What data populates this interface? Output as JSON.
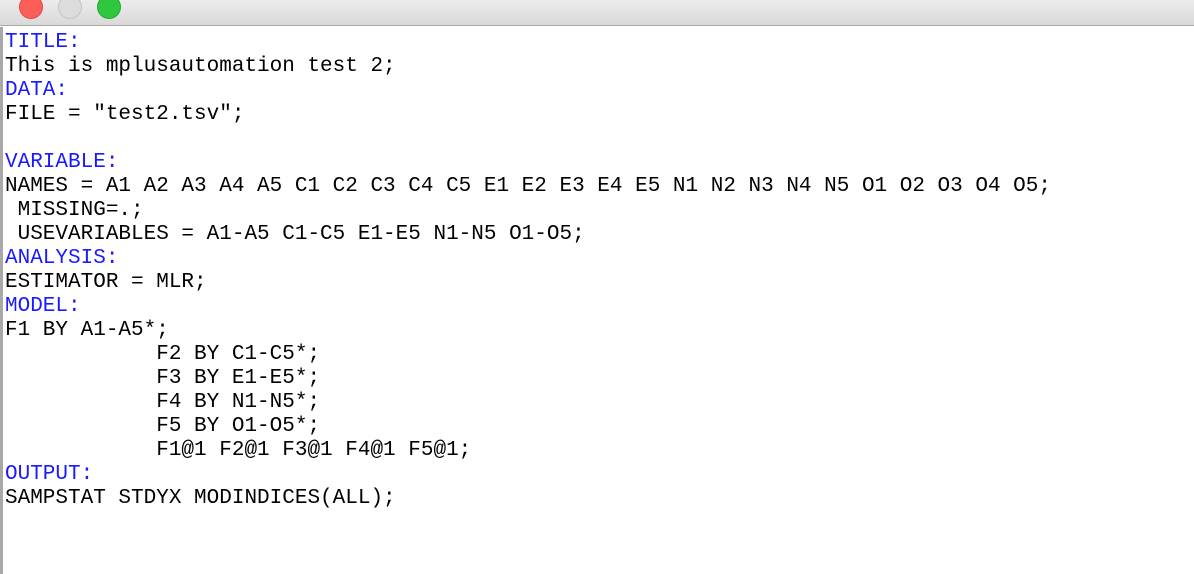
{
  "window": {
    "controls": {
      "close": "close-button",
      "minimize": "minimize-button",
      "zoom": "zoom-button"
    }
  },
  "colors": {
    "keyword": "#1a1aff",
    "text": "#000000"
  },
  "editor": {
    "lines": [
      {
        "text": "TITLE:",
        "type": "keyword"
      },
      {
        "text": "This is mplusautomation test 2;",
        "type": "text"
      },
      {
        "text": "DATA:",
        "type": "keyword"
      },
      {
        "text": "FILE = \"test2.tsv\";",
        "type": "text"
      },
      {
        "text": "",
        "type": "text"
      },
      {
        "text": "VARIABLE:",
        "type": "keyword"
      },
      {
        "text": "NAMES = A1 A2 A3 A4 A5 C1 C2 C3 C4 C5 E1 E2 E3 E4 E5 N1 N2 N3 N4 N5 O1 O2 O3 O4 O5;",
        "type": "text"
      },
      {
        "text": " MISSING=.;",
        "type": "text"
      },
      {
        "text": " USEVARIABLES = A1-A5 C1-C5 E1-E5 N1-N5 O1-O5;",
        "type": "text"
      },
      {
        "text": "ANALYSIS:",
        "type": "keyword"
      },
      {
        "text": "ESTIMATOR = MLR;",
        "type": "text"
      },
      {
        "text": "MODEL:",
        "type": "keyword"
      },
      {
        "text": "F1 BY A1-A5*;",
        "type": "text"
      },
      {
        "text": "            F2 BY C1-C5*;",
        "type": "text"
      },
      {
        "text": "            F3 BY E1-E5*;",
        "type": "text"
      },
      {
        "text": "            F4 BY N1-N5*;",
        "type": "text"
      },
      {
        "text": "            F5 BY O1-O5*;",
        "type": "text"
      },
      {
        "text": "            F1@1 F2@1 F3@1 F4@1 F5@1;",
        "type": "text"
      },
      {
        "text": "OUTPUT:",
        "type": "keyword"
      },
      {
        "text": "SAMPSTAT STDYX MODINDICES(ALL);",
        "type": "text"
      }
    ]
  }
}
